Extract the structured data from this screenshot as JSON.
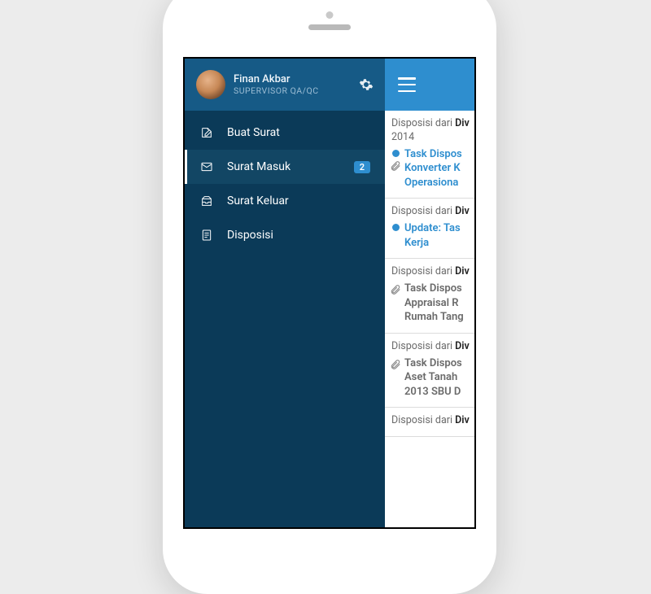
{
  "user": {
    "name": "Finan Akbar",
    "role": "SUPERVISOR QA/QC"
  },
  "menu": {
    "items": [
      {
        "label": "Buat Surat",
        "icon": "compose-icon"
      },
      {
        "label": "Surat Masuk",
        "icon": "inbox-icon",
        "badge": "2",
        "active": true
      },
      {
        "label": "Surat Keluar",
        "icon": "outbox-icon"
      },
      {
        "label": "Disposisi",
        "icon": "document-icon"
      }
    ]
  },
  "list": {
    "from_prefix": "Disposisi dari ",
    "from_name": "Div",
    "items": [
      {
        "date": "2014",
        "unread": true,
        "attachment": true,
        "title_lines": [
          "Task Dispos",
          "Konverter K",
          "Operasiona"
        ]
      },
      {
        "date": "",
        "unread": true,
        "attachment": false,
        "title_lines": [
          "Update: Tas",
          "Kerja"
        ]
      },
      {
        "date": "",
        "unread": false,
        "attachment": true,
        "title_lines": [
          "Task Dispos",
          "Appraisal R",
          "Rumah Tang"
        ]
      },
      {
        "date": "",
        "unread": false,
        "attachment": true,
        "title_lines": [
          "Task Dispos",
          "Aset Tanah",
          "2013 SBU D"
        ]
      }
    ]
  }
}
